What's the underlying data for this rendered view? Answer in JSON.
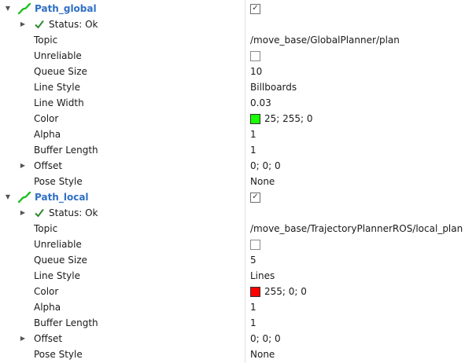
{
  "displays": [
    {
      "name": "Path_global",
      "enabled": true,
      "status": "Status: Ok",
      "properties": {
        "topic": {
          "label": "Topic",
          "value": "/move_base/GlobalPlanner/plan"
        },
        "unreliable": {
          "label": "Unreliable",
          "checked": false
        },
        "queue_size": {
          "label": "Queue Size",
          "value": "10"
        },
        "line_style": {
          "label": "Line Style",
          "value": "Billboards"
        },
        "line_width": {
          "label": "Line Width",
          "value": "0.03"
        },
        "color": {
          "label": "Color",
          "value": "25; 255; 0",
          "hex": "#19ff00"
        },
        "alpha": {
          "label": "Alpha",
          "value": "1"
        },
        "buffer_length": {
          "label": "Buffer Length",
          "value": "1"
        },
        "offset": {
          "label": "Offset",
          "value": "0; 0; 0"
        },
        "pose_style": {
          "label": "Pose Style",
          "value": "None"
        }
      }
    },
    {
      "name": "Path_local",
      "enabled": true,
      "status": "Status: Ok",
      "properties": {
        "topic": {
          "label": "Topic",
          "value": "/move_base/TrajectoryPlannerROS/local_plan"
        },
        "unreliable": {
          "label": "Unreliable",
          "checked": false
        },
        "queue_size": {
          "label": "Queue Size",
          "value": "5"
        },
        "line_style": {
          "label": "Line Style",
          "value": "Lines"
        },
        "color": {
          "label": "Color",
          "value": "255; 0; 0",
          "hex": "#ff0000"
        },
        "alpha": {
          "label": "Alpha",
          "value": "1"
        },
        "buffer_length": {
          "label": "Buffer Length",
          "value": "1"
        },
        "offset": {
          "label": "Offset",
          "value": "0; 0; 0"
        },
        "pose_style": {
          "label": "Pose Style",
          "value": "None"
        }
      }
    }
  ],
  "icons": {
    "path_icon": "path-display-icon",
    "status_icon": "check-icon",
    "expand_icon": "triangle-down-icon",
    "collapse_icon": "triangle-right-icon"
  },
  "colors": {
    "display_name": "#2f6fc4",
    "path_icon": "#1fbf1f",
    "status_check": "#2e8b2e"
  }
}
